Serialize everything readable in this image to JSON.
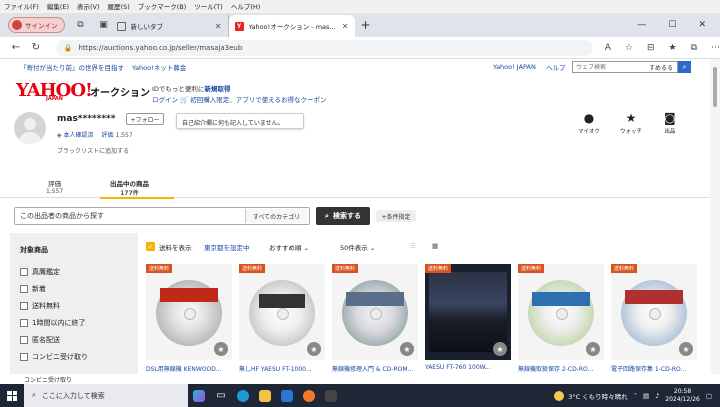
{
  "menubar": [
    "ファイル(F)",
    "編集(E)",
    "表示(V)",
    "履歴(S)",
    "ブックマーク(B)",
    "ツール(T)",
    "ヘルプ(H)"
  ],
  "browser": {
    "profile_label": "サインイン",
    "tabs": [
      {
        "title": "新しいタブ",
        "active": false
      },
      {
        "title": "Yahoo!オークション - masaja3eub3の...",
        "active": true
      }
    ],
    "url": "https://auctions.yahoo.co.jp/seller/masaja3eub"
  },
  "promo": {
    "link1": "「寄付が当たり前」の世界を目指す",
    "link2": "Yahoo!ネット募金",
    "right1": "Yahoo! JAPAN",
    "right2": "ヘルプ",
    "search_placeholder": "ウェブ検索",
    "search_button": "すめるる"
  },
  "header": {
    "logo": "YAHOO!",
    "logo_sub": "JAPAN",
    "service": "オークション",
    "login_prompt": "IDでもっと便利に",
    "register": "新規取得",
    "login": "ログイン",
    "coupon": "初回購入限定、アプリで使えるお得なクーポン"
  },
  "seller": {
    "name": "mas********",
    "follow": "+フォロー",
    "bio": "自己紹介欄に何も記入していません。",
    "verified": "本人確認済",
    "rating_label": "評価",
    "rating": "1,557",
    "blacklist": "ブラックリストに追加する"
  },
  "right_icons": [
    {
      "name": "person-icon",
      "label": "マイオク"
    },
    {
      "name": "star-icon",
      "label": "ウォッチ"
    },
    {
      "name": "camera-icon",
      "label": "出品"
    }
  ],
  "tabs_row": [
    {
      "label": "評価",
      "count": "1,557",
      "active": false
    },
    {
      "label": "出品中の商品",
      "count": "177件",
      "active": true
    }
  ],
  "shop_search": {
    "placeholder": "この出品者の商品から探す",
    "category": "すべてのカテゴリ",
    "button": "検索する",
    "conditions": "+条件指定"
  },
  "filter": {
    "title": "対象商品",
    "items": [
      "真贋鑑定",
      "新着",
      "送料無料",
      "1時間以内に終了",
      "匿名配送",
      "コンビニ受け取り",
      "コンビニ受け取り"
    ]
  },
  "results_bar": {
    "show_shipping": "送料を表示",
    "shipping_dest": "東京都を設定中",
    "sort": "おすすめ順",
    "per_page": "50件表示"
  },
  "products": [
    {
      "badge": "送料無料",
      "title": "DSL用無線機 KENWOOD..."
    },
    {
      "badge": "送料無料",
      "title": "無しHF YAESU FT-1000..."
    },
    {
      "badge": "送料無料",
      "title": "無線機修理入門 & CD-ROM..."
    },
    {
      "badge": "送料無料",
      "title": "YAESU FT-760 100W..."
    },
    {
      "badge": "送料無料",
      "title": "無線機取扱保存 2-CD-RO..."
    },
    {
      "badge": "送料無料",
      "title": "電子回路保存集 1-CD-RO..."
    }
  ],
  "taskbar": {
    "search": "ここに入力して検索",
    "weather": "3°C くもり時々晴れ",
    "time": "20:58",
    "date": "2024/12/26"
  },
  "colors": {
    "accent": "#f5b400",
    "link": "#1a47a6",
    "brand": "#e50012",
    "badge": "#d9531e"
  }
}
